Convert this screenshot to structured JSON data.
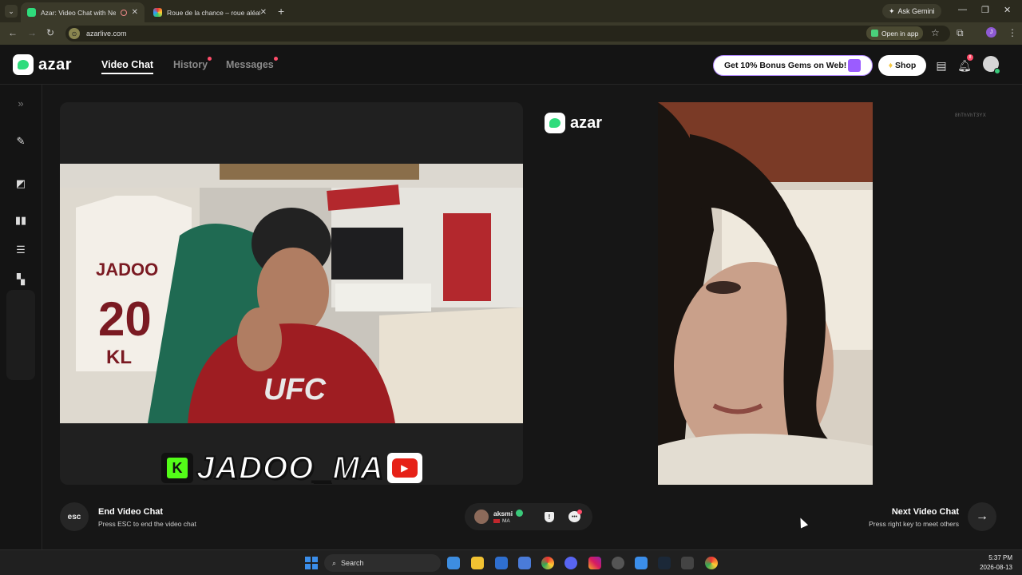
{
  "browser": {
    "tabs": [
      {
        "title": "Azar: Video Chat with New"
      },
      {
        "title": "Roue de la chance – roue aléat"
      }
    ],
    "ask_gemini": "Ask Gemini",
    "url": "azarlive.com",
    "open_in_app": "Open in app"
  },
  "header": {
    "logo": "azar",
    "nav": [
      "Video Chat",
      "History",
      "Messages"
    ],
    "gems_promo": "Get 10% Bonus Gems on Web!",
    "shop": "Shop",
    "bell_count": "8"
  },
  "stage": {
    "center_logo": "azar",
    "session_code": "8hThVhT3YX",
    "overlay_name": "JADOO_MA",
    "overlay_kick": "K"
  },
  "controls": {
    "esc": "esc",
    "end_title": "End Video Chat",
    "end_sub": "Press ESC to end the video chat",
    "partner_name": "aksmi",
    "partner_country": "MA",
    "next_title": "Next Video Chat",
    "next_sub": "Press right key to meet others"
  },
  "taskbar": {
    "search": "Search",
    "time": "5:37 PM",
    "date": "2026-08-13"
  },
  "colors": {
    "brand_green": "#2fdc7c",
    "notify_red": "#ff4d6a",
    "gems_border": "#b48cff"
  }
}
